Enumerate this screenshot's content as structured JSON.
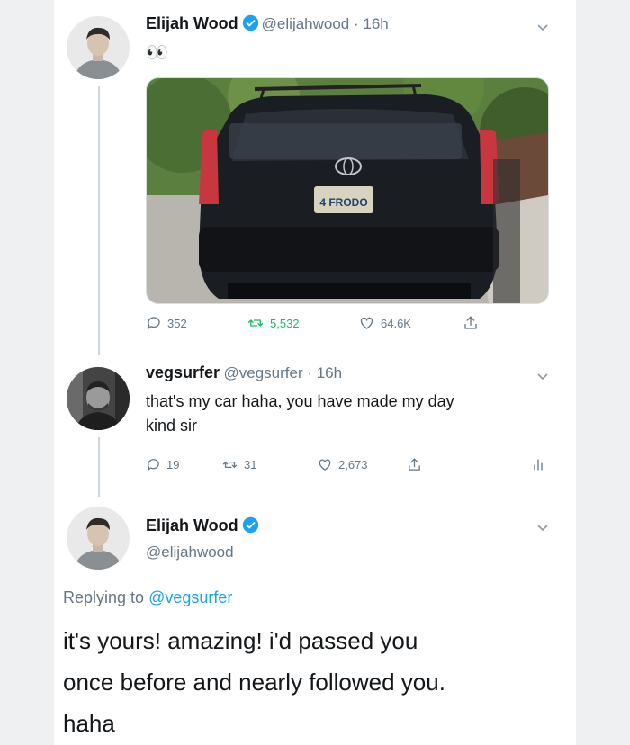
{
  "tweet1": {
    "name": "Elijah Wood",
    "meta": "@elijahwood · 16h",
    "text": "👀",
    "media": {
      "plate_text": "4 FRODO"
    },
    "actions": {
      "replies": "352",
      "retweets": "5,532",
      "likes": "64.6K"
    }
  },
  "tweet2": {
    "name": "vegsurfer",
    "meta": "@vegsurfer · 16h",
    "text_line1": "that's my car haha, you have made my day",
    "text_line2": "kind sir",
    "actions": {
      "replies": "19",
      "retweets": "31",
      "likes": "2,673"
    }
  },
  "tweet3": {
    "name": "Elijah Wood",
    "handle": "@elijahwood",
    "replying_prefix": "Replying to ",
    "replying_to": "@vegsurfer",
    "text_line1": "it's yours! amazing! i'd passed you",
    "text_line2": "once before and nearly followed you.",
    "text_line3": "haha"
  },
  "colors": {
    "verified": "#1da1f2",
    "link": "#1da1f2",
    "muted": "#657786",
    "retweet": "#17bf63"
  }
}
